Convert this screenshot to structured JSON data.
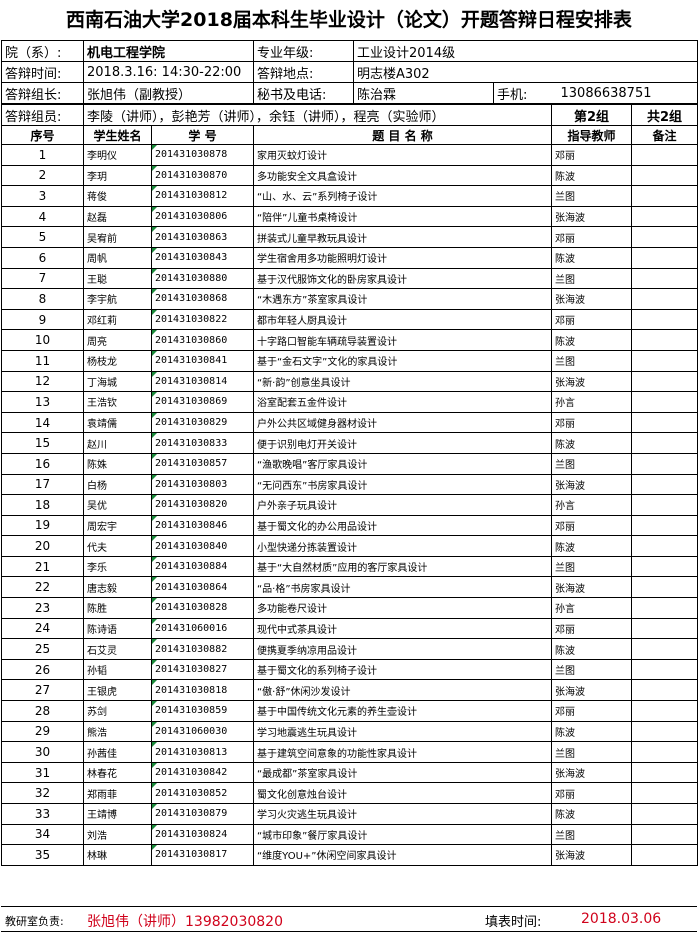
{
  "title": "西南石油大学2018届本科生毕业设计（论文）开题答辩日程安排表",
  "header": {
    "dept_label": "院（系）:",
    "dept_value": "机电工程学院",
    "major_label": "专业年级:",
    "major_value": "工业设计2014级",
    "time_label": "答辩时间:",
    "time_value": "2018.3.16: 14:30-22:00",
    "place_label": "答辩地点:",
    "place_value": "明志楼A302",
    "leader_label": "答辩组长:",
    "leader_value": "张旭伟（副教授）",
    "secretary_label": "秘书及电话:",
    "secretary_value": "陈治霖",
    "phone_label": "手机:",
    "phone_value": "13086638751",
    "members_label": "答辩组员:",
    "members_value": "李陵（讲师），彭艳芳（讲师），余钰（讲师），程亮（实验师）",
    "group_value": "第2组",
    "total_value": "共2组"
  },
  "table": {
    "columns": [
      "序号",
      "学生姓名",
      "学 号",
      "题 目 名 称",
      "指导教师",
      "备注"
    ],
    "rows": [
      {
        "no": "1",
        "name": "李明仪",
        "sid": "201431030878",
        "topic": "家用灭蚊灯设计",
        "advisor": "邓丽",
        "note": ""
      },
      {
        "no": "2",
        "name": "李玥",
        "sid": "201431030870",
        "topic": "多功能安全文具盒设计",
        "advisor": "陈波",
        "note": ""
      },
      {
        "no": "3",
        "name": "蒋俊",
        "sid": "201431030812",
        "topic": "“山、水、云”系列椅子设计",
        "advisor": "兰图",
        "note": ""
      },
      {
        "no": "4",
        "name": "赵磊",
        "sid": "201431030806",
        "topic": "“陪伴”儿童书桌椅设计",
        "advisor": "张海波",
        "note": ""
      },
      {
        "no": "5",
        "name": "吴宥前",
        "sid": "201431030863",
        "topic": "拼装式儿童早教玩具设计",
        "advisor": "邓丽",
        "note": ""
      },
      {
        "no": "6",
        "name": "周帆",
        "sid": "201431030843",
        "topic": "学生宿舍用多功能照明灯设计",
        "advisor": "陈波",
        "note": ""
      },
      {
        "no": "7",
        "name": "王聪",
        "sid": "201431030880",
        "topic": "基于汉代服饰文化的卧房家具设计",
        "advisor": "兰图",
        "note": ""
      },
      {
        "no": "8",
        "name": "李宇航",
        "sid": "201431030868",
        "topic": "“木遇东方”茶室家具设计",
        "advisor": "张海波",
        "note": ""
      },
      {
        "no": "9",
        "name": "邓红莉",
        "sid": "201431030822",
        "topic": "都市年轻人厨具设计",
        "advisor": "邓丽",
        "note": ""
      },
      {
        "no": "10",
        "name": "周亮",
        "sid": "201431030860",
        "topic": "十字路口智能车辆疏导装置设计",
        "advisor": "陈波",
        "note": ""
      },
      {
        "no": "11",
        "name": "杨枝龙",
        "sid": "201431030841",
        "topic": "基于“金石文字”文化的家具设计",
        "advisor": "兰图",
        "note": ""
      },
      {
        "no": "12",
        "name": "丁海城",
        "sid": "201431030814",
        "topic": "“新·韵”创意坐具设计",
        "advisor": "张海波",
        "note": ""
      },
      {
        "no": "13",
        "name": "王浩钦",
        "sid": "201431030869",
        "topic": "浴室配套五金件设计",
        "advisor": "孙言",
        "note": ""
      },
      {
        "no": "14",
        "name": "袁靖儒",
        "sid": "201431030829",
        "topic": "户外公共区域健身器材设计",
        "advisor": "邓丽",
        "note": ""
      },
      {
        "no": "15",
        "name": "赵川",
        "sid": "201431030833",
        "topic": "便于识别电灯开关设计",
        "advisor": "陈波",
        "note": ""
      },
      {
        "no": "16",
        "name": "陈姝",
        "sid": "201431030857",
        "topic": "“渔歌晚唱”客厅家具设计",
        "advisor": "兰图",
        "note": ""
      },
      {
        "no": "17",
        "name": "白杨",
        "sid": "201431030803",
        "topic": "“无问西东”书房家具设计",
        "advisor": "张海波",
        "note": ""
      },
      {
        "no": "18",
        "name": "吴优",
        "sid": "201431030820",
        "topic": "户外亲子玩具设计",
        "advisor": "孙言",
        "note": ""
      },
      {
        "no": "19",
        "name": "周宏宇",
        "sid": "201431030846",
        "topic": "基于蜀文化的办公用品设计",
        "advisor": "邓丽",
        "note": ""
      },
      {
        "no": "20",
        "name": "代夫",
        "sid": "201431030840",
        "topic": "小型快递分拣装置设计",
        "advisor": "陈波",
        "note": ""
      },
      {
        "no": "21",
        "name": "李乐",
        "sid": "201431030884",
        "topic": "基于“大自然材质”应用的客厅家具设计",
        "advisor": "兰图",
        "note": ""
      },
      {
        "no": "22",
        "name": "唐志毅",
        "sid": "201431030864",
        "topic": "“品·格”书房家具设计",
        "advisor": "张海波",
        "note": ""
      },
      {
        "no": "23",
        "name": "陈胜",
        "sid": "201431030828",
        "topic": "多功能卷尺设计",
        "advisor": "孙言",
        "note": ""
      },
      {
        "no": "24",
        "name": "陈诗语",
        "sid": "201431060016",
        "topic": "现代中式茶具设计",
        "advisor": "邓丽",
        "note": ""
      },
      {
        "no": "25",
        "name": "石艾灵",
        "sid": "201431030882",
        "topic": "便携夏季纳凉用品设计",
        "advisor": "陈波",
        "note": ""
      },
      {
        "no": "26",
        "name": "孙韬",
        "sid": "201431030827",
        "topic": "基于蜀文化的系列椅子设计",
        "advisor": "兰图",
        "note": ""
      },
      {
        "no": "27",
        "name": "王银虎",
        "sid": "201431030818",
        "topic": "“傲·舒”休闲沙发设计",
        "advisor": "张海波",
        "note": ""
      },
      {
        "no": "28",
        "name": "苏剑",
        "sid": "201431030859",
        "topic": "基于中国传统文化元素的养生壶设计",
        "advisor": "邓丽",
        "note": ""
      },
      {
        "no": "29",
        "name": "熊浩",
        "sid": "201431060030",
        "topic": "学习地震逃生玩具设计",
        "advisor": "陈波",
        "note": ""
      },
      {
        "no": "30",
        "name": "孙茜佳",
        "sid": "201431030813",
        "topic": "基于建筑空间意象的功能性家具设计",
        "advisor": "兰图",
        "note": ""
      },
      {
        "no": "31",
        "name": "林春花",
        "sid": "201431030842",
        "topic": "“最成都”茶室家具设计",
        "advisor": "张海波",
        "note": ""
      },
      {
        "no": "32",
        "name": "郑雨菲",
        "sid": "201431030852",
        "topic": "蜀文化创意烛台设计",
        "advisor": "邓丽",
        "note": ""
      },
      {
        "no": "33",
        "name": "王靖博",
        "sid": "201431030879",
        "topic": "学习火灾逃生玩具设计",
        "advisor": "陈波",
        "note": ""
      },
      {
        "no": "34",
        "name": "刘浩",
        "sid": "201431030824",
        "topic": "“城市印象”餐厅家具设计",
        "advisor": "兰图",
        "note": ""
      },
      {
        "no": "35",
        "name": "林琳",
        "sid": "201431030817",
        "topic": "“维度YOU+”休闲空间家具设计",
        "advisor": "张海波",
        "note": ""
      }
    ]
  },
  "footer": {
    "office_label": "教研室负责:",
    "office_value": "张旭伟（讲师）13982030820",
    "date_label": "填表时间:",
    "date_value": "2018.03.06"
  },
  "colors": {
    "accent_red": "#d0021b",
    "corner_marker_green": "#1a8a3a"
  }
}
